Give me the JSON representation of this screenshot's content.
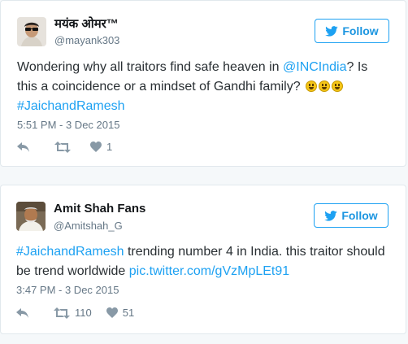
{
  "colors": {
    "link": "#1da1f2",
    "muted": "#657786",
    "border": "#e1e8ed"
  },
  "tweets": [
    {
      "display_name": "मयंक ओमर™",
      "handle": "@mayank303",
      "follow_label": "Follow",
      "text_before_link": "Wondering why all traitors find safe heaven in ",
      "mention": "@INCIndia",
      "text_after_link": "? Is this a coincidence or a mindset of Gandhi family? ",
      "hashtag": "#JaichandRamesh",
      "timestamp": "5:51 PM - 3 Dec 2015",
      "retweets": "",
      "likes": "1",
      "icons": [
        "twitter-bird-icon",
        "reply-icon",
        "retweet-icon",
        "heart-icon"
      ]
    },
    {
      "display_name": "Amit Shah Fans",
      "handle": "@Amitshah_G",
      "follow_label": "Follow",
      "hashtag": "#JaichandRamesh",
      "text_after_hashtag": " trending number 4 in India. this traitor should be trend worldwide ",
      "pic_link": "pic.twitter.com/gVzMpLEt91",
      "timestamp": "3:47 PM - 3 Dec 2015",
      "retweets": "110",
      "likes": "51",
      "icons": [
        "twitter-bird-icon",
        "reply-icon",
        "retweet-icon",
        "heart-icon"
      ]
    }
  ]
}
